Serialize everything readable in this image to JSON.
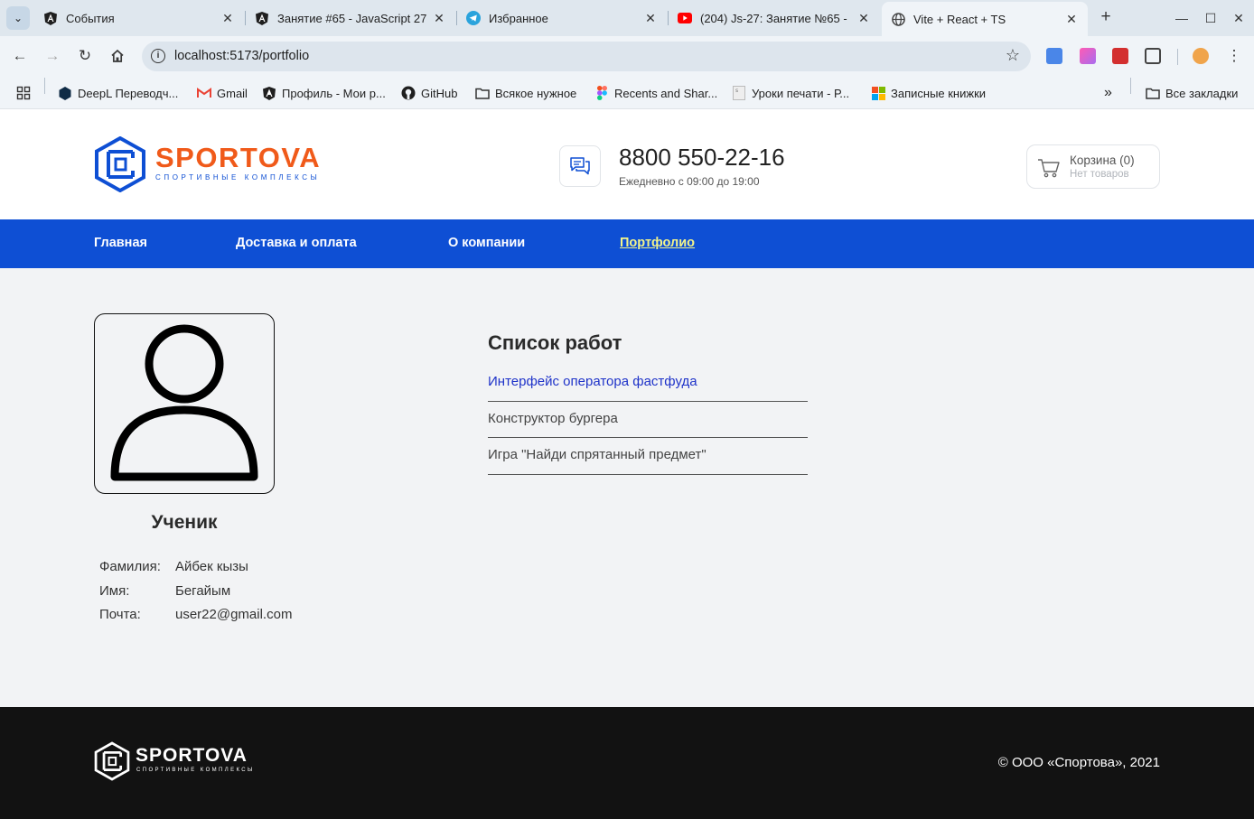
{
  "browser": {
    "tabs": [
      {
        "title": "События",
        "icon": "angular-icon"
      },
      {
        "title": "Занятие #65 - JavaScript 27",
        "icon": "angular-icon"
      },
      {
        "title": "Избранное",
        "icon": "telegram-icon"
      },
      {
        "title": "(204) Js-27: Занятие №65 -",
        "icon": "youtube-icon"
      },
      {
        "title": "Vite + React + TS",
        "icon": "globe-icon"
      }
    ],
    "url": "localhost:5173/portfolio",
    "bookmarks": [
      {
        "label": "DeepL Переводч...",
        "icon": "deepl-icon"
      },
      {
        "label": "Gmail",
        "icon": "gmail-icon"
      },
      {
        "label": "Профиль - Мои р...",
        "icon": "angular-icon"
      },
      {
        "label": "GitHub",
        "icon": "github-icon"
      },
      {
        "label": "Всякое нужное",
        "icon": "folder-icon"
      },
      {
        "label": "Recents and Shar...",
        "icon": "figma-icon"
      },
      {
        "label": "Уроки печати - Р...",
        "icon": "page-icon"
      },
      {
        "label": "Записные книжки",
        "icon": "microsoft-icon"
      }
    ],
    "all_bookmarks": "Все закладки"
  },
  "site": {
    "logo": {
      "name": "SPORTOVA",
      "tagline": "СПОРТИВНЫЕ КОМПЛЕКСЫ"
    },
    "phone": "8800 550-22-16",
    "hours": "Ежедневно с 09:00 до 19:00",
    "cart": {
      "label": "Корзина (0)",
      "sub": "Нет товаров"
    },
    "nav": [
      {
        "label": "Главная"
      },
      {
        "label": "Доставка и оплата"
      },
      {
        "label": "О компании"
      },
      {
        "label": "Портфолио"
      }
    ],
    "colors": {
      "brand_orange": "#f05a1a",
      "brand_blue": "#0e4fd4",
      "active_link": "#f3f48a"
    }
  },
  "profile": {
    "title": "Ученик",
    "fields": [
      {
        "label": "Фамилия:",
        "value": "Айбек кызы"
      },
      {
        "label": "Имя:",
        "value": "Бегайым"
      },
      {
        "label": "Почта:",
        "value": "user22@gmail.com"
      }
    ]
  },
  "works": {
    "title": "Список работ",
    "items": [
      "Интерфейс оператора фастфуда",
      "Конструктор бургера",
      "Игра \"Найди спрятанный предмет\""
    ]
  },
  "footer": {
    "logo_name": "SPORTOVA",
    "logo_tagline": "СПОРТИВНЫЕ КОМПЛЕКСЫ",
    "copyright": "© ООО «Спортова», 2021"
  }
}
